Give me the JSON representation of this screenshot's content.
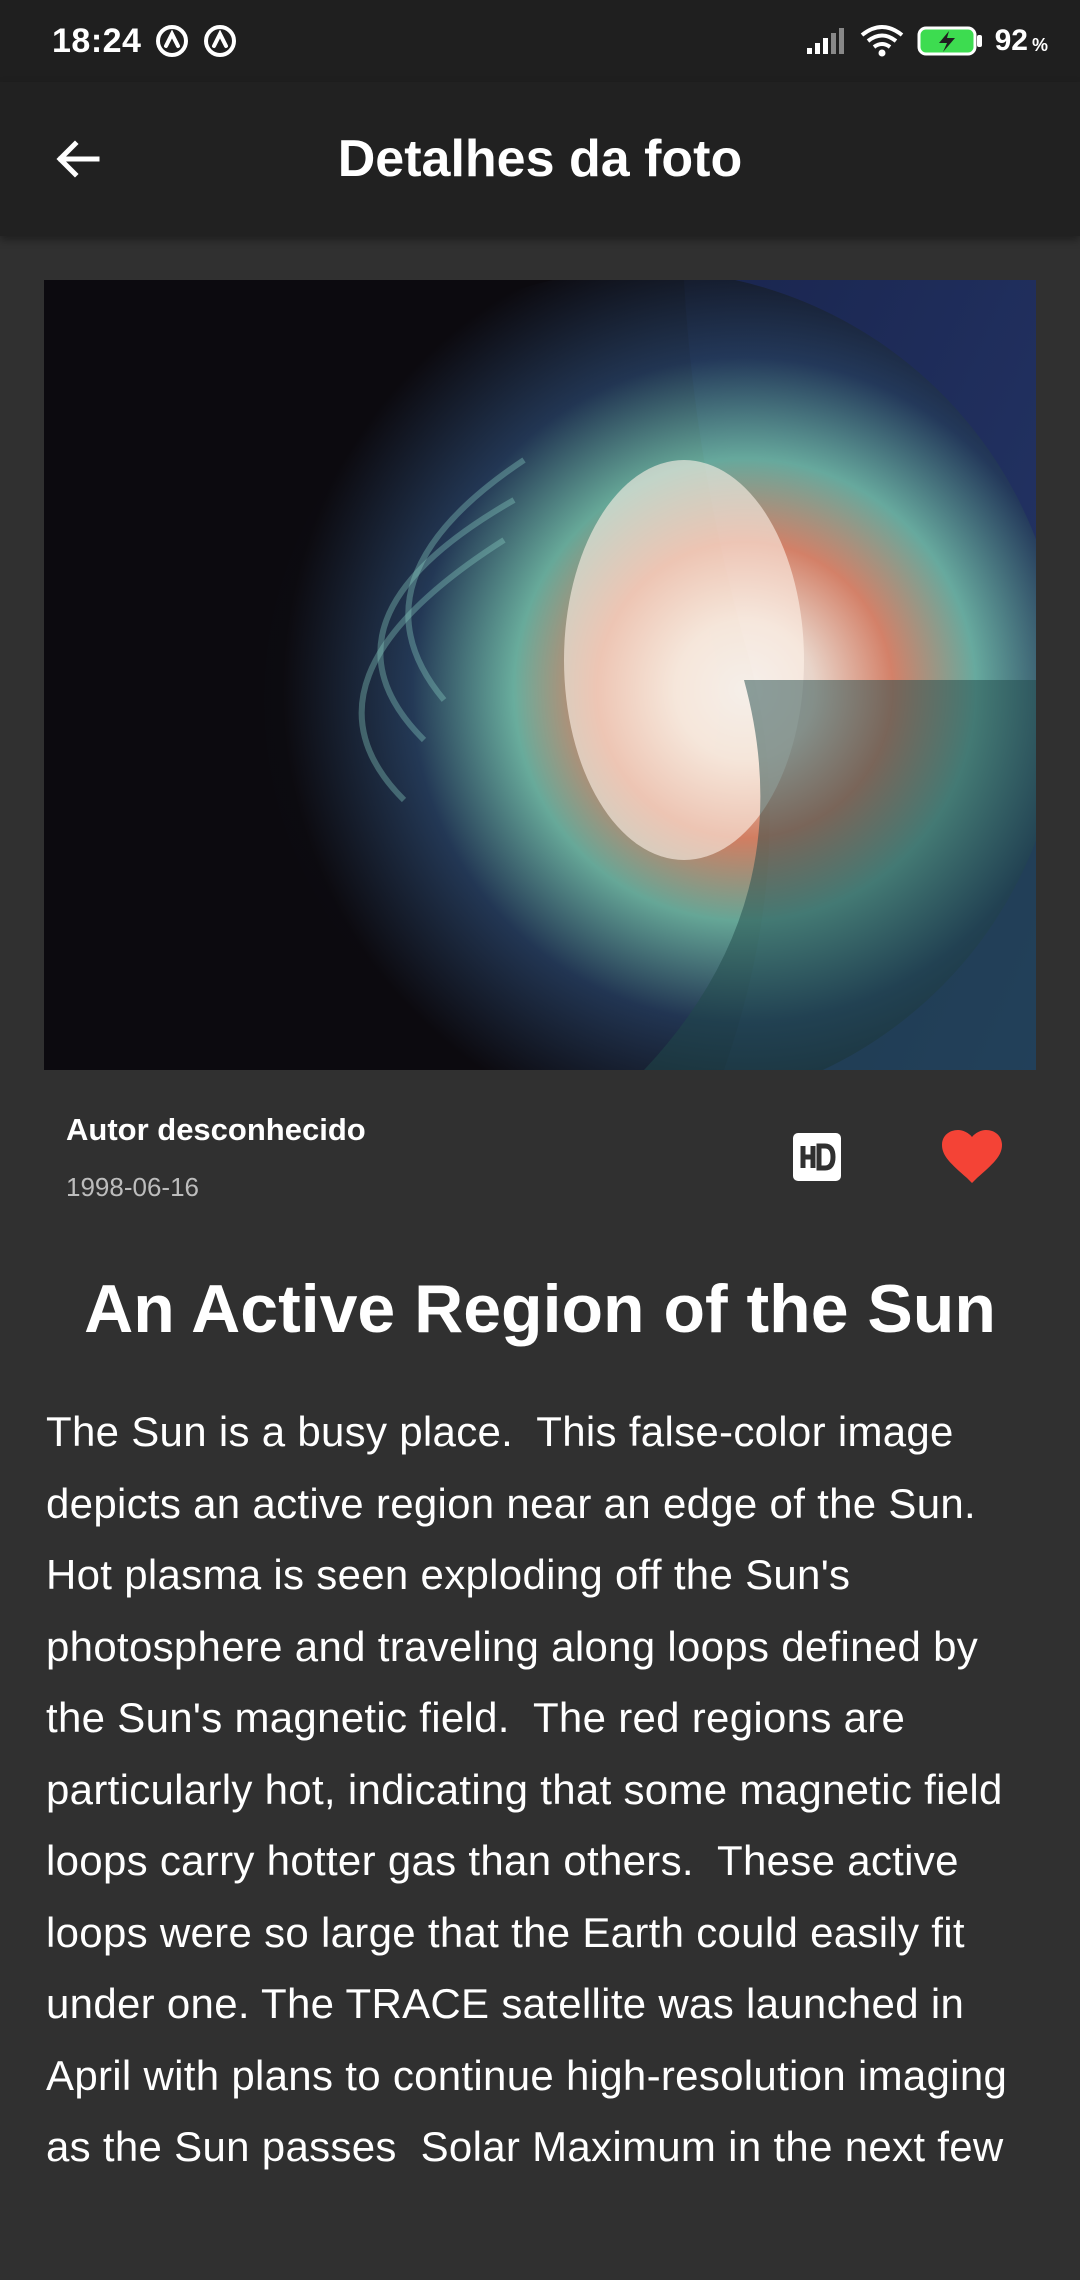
{
  "status_bar": {
    "time": "18:24",
    "battery_level": "92",
    "battery_unit": "%",
    "icons": [
      "notification-icon",
      "notification-icon",
      "signal-icon",
      "wifi-icon",
      "battery-charging-icon"
    ]
  },
  "app_bar": {
    "title": "Detalhes da foto",
    "back_icon": "arrow-back-icon"
  },
  "photo": {
    "author": "Autor desconhecido",
    "date": "1998-06-16",
    "hd_icon": "hd-icon",
    "favorite_icon": "heart-icon",
    "favorite_color": "#f44336"
  },
  "content": {
    "title": "An Active Region of the Sun",
    "explanation": "The Sun is a busy place.  This false-color image depicts an active region near an edge of the Sun.  Hot plasma is seen exploding off the Sun's photosphere and traveling along loops defined by the Sun's magnetic field.  The red regions are particularly hot, indicating that some magnetic field loops carry hotter gas than others.  These active loops were so large that the Earth could easily fit under one. The TRACE satellite was launched in April with plans to continue high-resolution imaging as the Sun passes  Solar Maximum in the next few"
  },
  "colors": {
    "background": "#303030",
    "app_bar": "#212121",
    "status_bar": "#1f1f1f",
    "text": "#ffffff",
    "date_text": "#bdbdbd"
  }
}
